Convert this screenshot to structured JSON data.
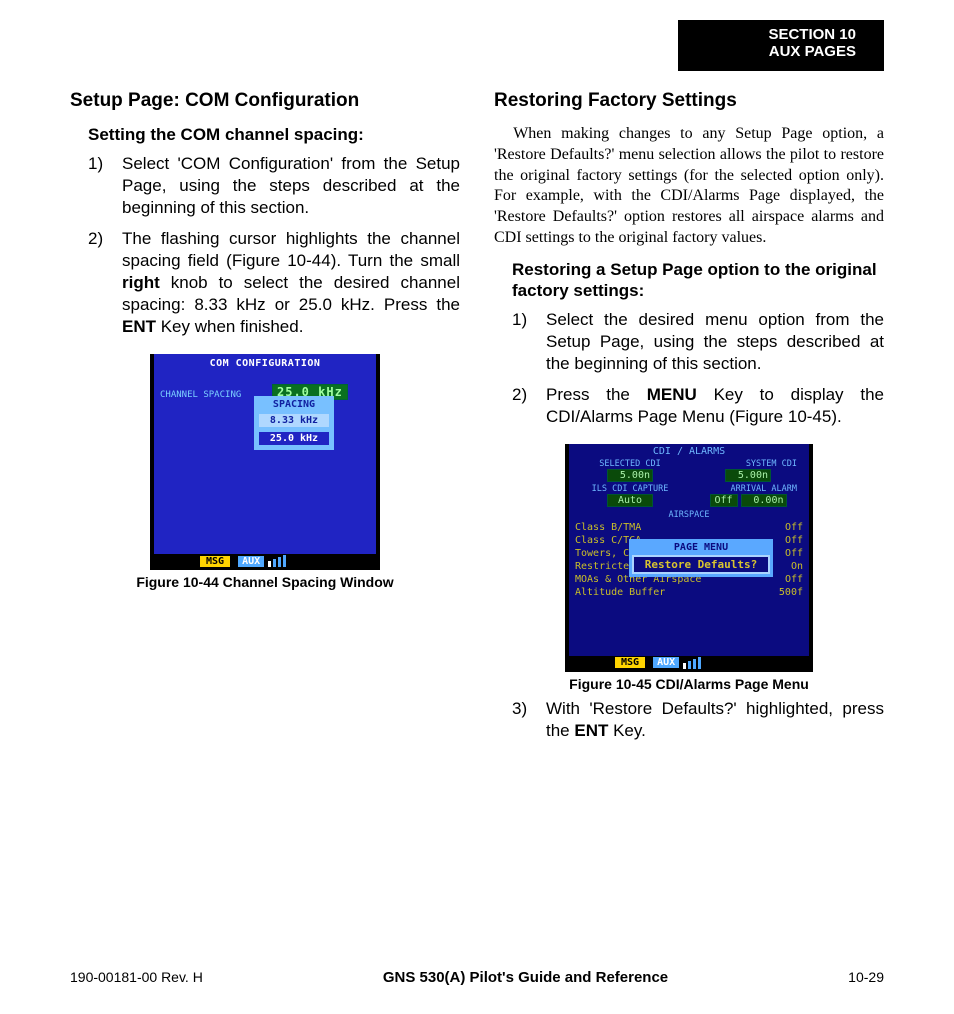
{
  "header": {
    "section_line1": "SECTION 10",
    "section_line2": "AUX PAGES"
  },
  "left": {
    "h2": "Setup Page: COM Configuration",
    "h3": "Setting the COM channel spacing:",
    "steps": [
      "Select 'COM Configuration' from the Setup Page, using the steps described at the beginning of this section.",
      "The flashing cursor highlights the channel spacing field (Figure 10-44). Turn the small <b>right</b> knob to select the desired channel spacing: 8.33 kHz or 25.0 kHz. Press the <b>ENT</b> Key when finished."
    ],
    "fig44": {
      "title": "COM CONFIGURATION",
      "label": "CHANNEL SPACING",
      "current": "25.0 kHz",
      "popup_title": "SPACING",
      "opt1": "8.33 kHz",
      "opt2": "25.0 kHz",
      "msg": "MSG",
      "aux": "AUX",
      "caption": "Figure 10-44  Channel Spacing Window"
    }
  },
  "right": {
    "h2": "Restoring Factory Settings",
    "para": "When making changes to any Setup Page option, a 'Restore Defaults?' menu selection allows the pilot to restore the original factory settings (for the selected option only).  For example, with the CDI/Alarms Page displayed, the 'Restore Defaults?' option restores all airspace alarms and CDI settings to the original factory values.",
    "h3": "Restoring a Setup Page option to the original factory settings:",
    "steps12": [
      "Select the desired menu option from the Setup Page, using the steps described at the beginning of this section.",
      "Press the <b>MENU</b> Key to display the CDI/Alarms Page Menu (Figure 10-45)."
    ],
    "step3": "With 'Restore Defaults?' highlighted, press the <b>ENT</b> Key.",
    "fig45": {
      "title": "CDI / ALARMS",
      "sel_cdi_label": "SELECTED CDI",
      "sel_cdi_val": "5.00n",
      "sys_cdi_label": "SYSTEM CDI",
      "sys_cdi_val": "5.00n",
      "ils_label": "ILS CDI CAPTURE",
      "ils_val": "Auto",
      "arr_label": "ARRIVAL ALARM",
      "arr_off": "Off",
      "arr_dist": "0.00n",
      "airspace_label": "AIRSPACE",
      "lines": [
        {
          "l": "Class B/TMA",
          "v": "Off"
        },
        {
          "l": "Class C/TCA",
          "v": "Off"
        },
        {
          "l": "Towers, Control Zones",
          "v": "Off"
        },
        {
          "l": "Restricted",
          "v": "On"
        },
        {
          "l": "MOAs & Other Airspace",
          "v": "Off"
        },
        {
          "l": "Altitude Buffer",
          "v": "500f"
        }
      ],
      "menu_title": "PAGE MENU",
      "menu_item": "Restore Defaults?",
      "msg": "MSG",
      "aux": "AUX",
      "caption": "Figure 10-45  CDI/Alarms Page Menu"
    }
  },
  "footer": {
    "left": "190-00181-00  Rev. H",
    "center": "GNS 530(A) Pilot's Guide and Reference",
    "right": "10-29"
  }
}
